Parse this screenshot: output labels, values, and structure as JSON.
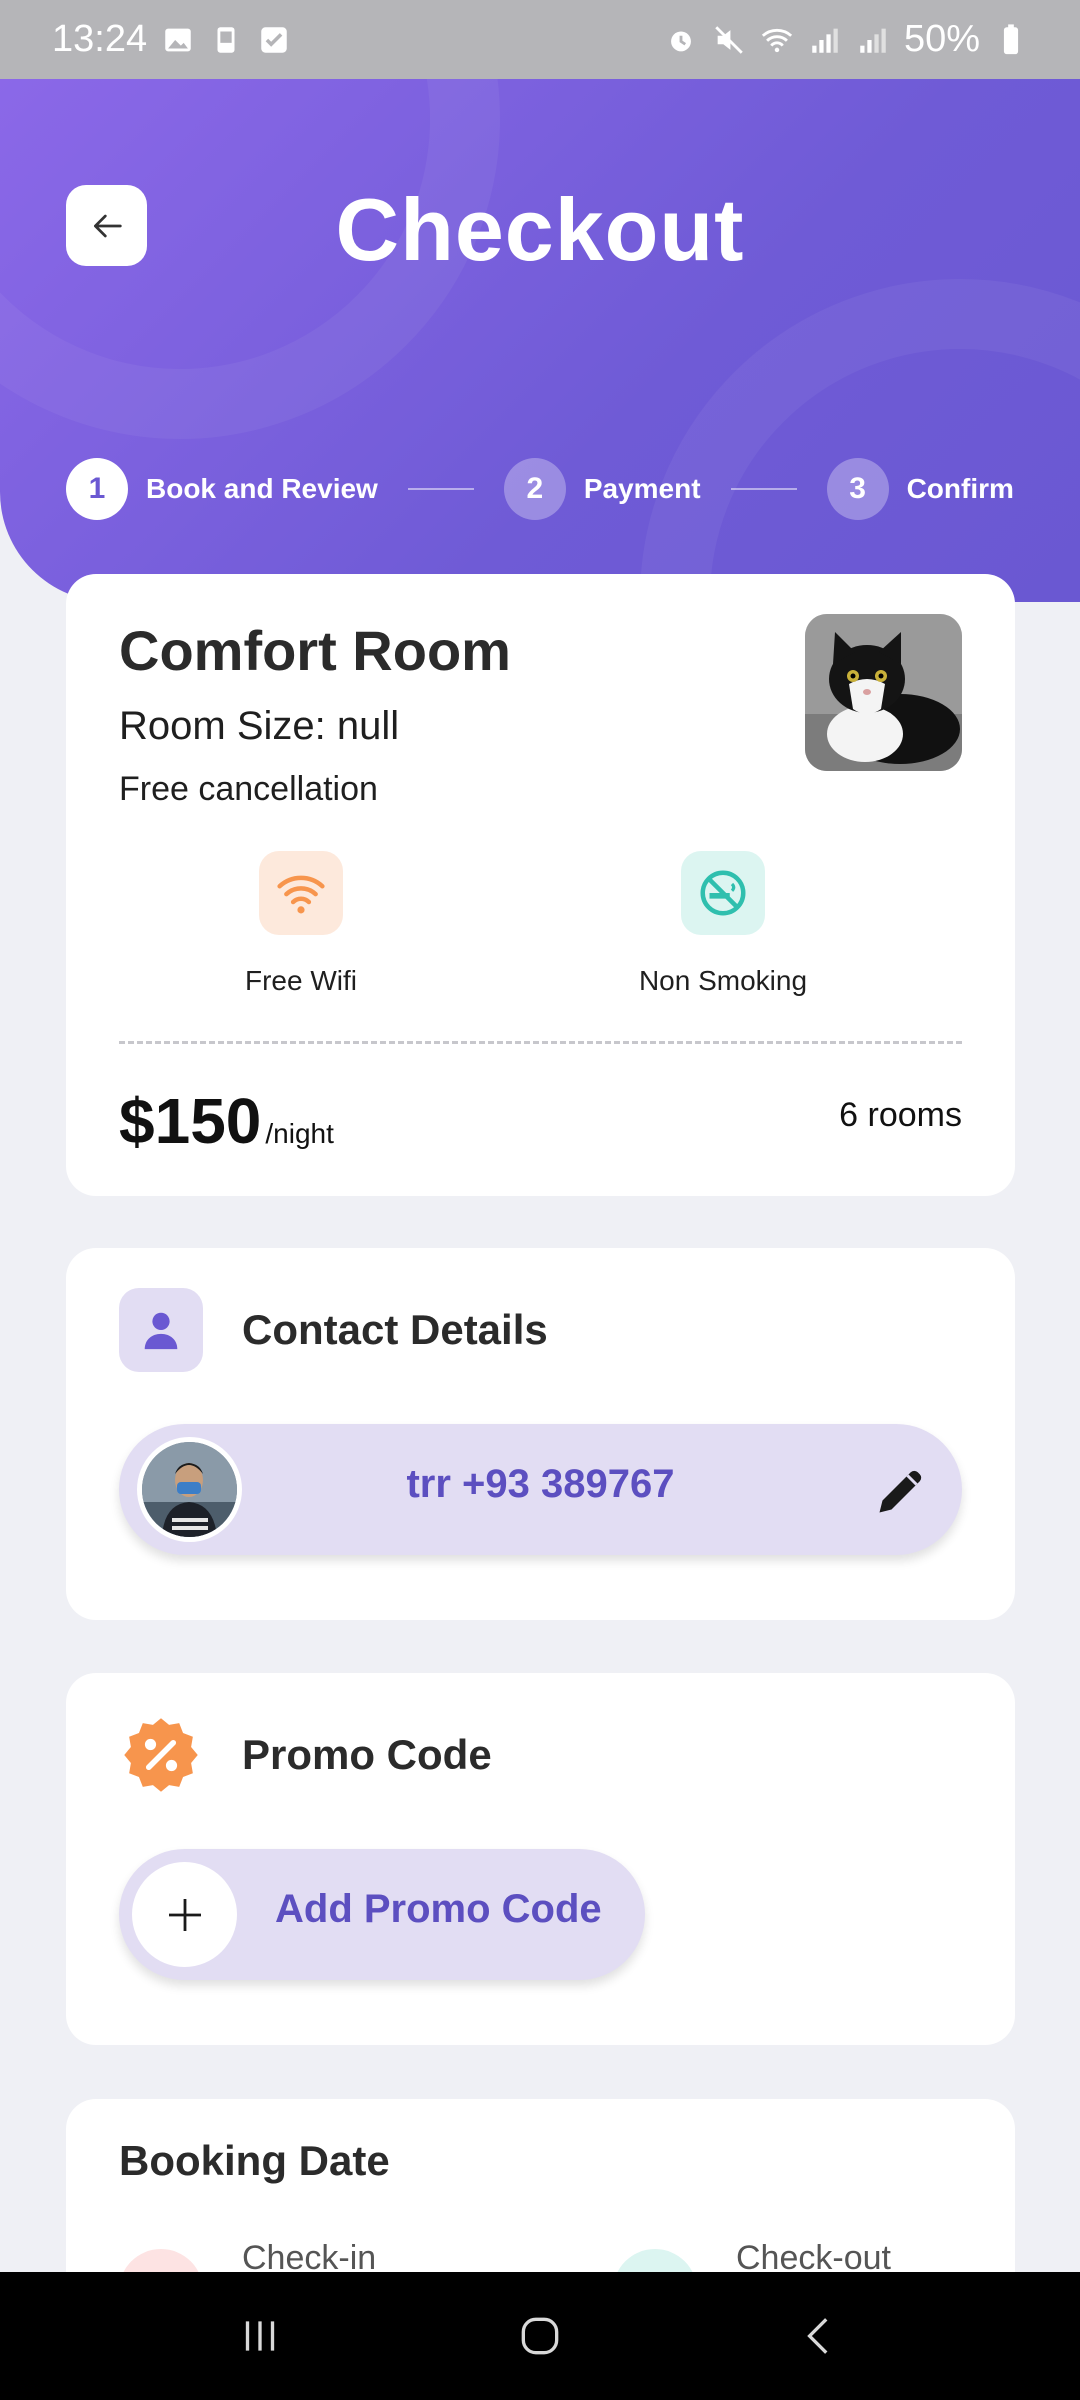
{
  "status_bar": {
    "time": "13:24",
    "battery": "50%",
    "icons_left": [
      "gallery-icon",
      "cast-icon",
      "checkbox-icon"
    ],
    "icons_right": [
      "alarm-icon",
      "mute-icon",
      "wifi-icon",
      "signal-icon",
      "signal-icon",
      "battery-icon"
    ]
  },
  "header": {
    "title": "Checkout",
    "back_icon": "arrow-left-icon",
    "steps": [
      {
        "number": "1",
        "label": "Book and Review",
        "active": true
      },
      {
        "number": "2",
        "label": "Payment",
        "active": false
      },
      {
        "number": "3",
        "label": "Confirm",
        "active": false
      }
    ]
  },
  "room": {
    "title": "Comfort Room",
    "size_text": "Room Size: null",
    "cancellation": "Free cancellation",
    "photo": "cat-photo",
    "amenities": [
      {
        "label": "Free Wifi",
        "icon": "wifi-icon",
        "color": "#f7954d",
        "bg": "#fde9dc"
      },
      {
        "label": "Non Smoking",
        "icon": "no-smoking-icon",
        "color": "#2fbfae",
        "bg": "#dcf5f1"
      }
    ],
    "price": "$150",
    "price_unit": "/night",
    "rooms": "6 rooms"
  },
  "contact": {
    "title": "Contact Details",
    "icon": "person-icon",
    "value": "trr +93 389767",
    "edit_icon": "pencil-icon"
  },
  "promo": {
    "title": "Promo Code",
    "icon": "discount-badge-icon",
    "button_label": "Add Promo Code"
  },
  "booking": {
    "title": "Booking Date",
    "checkin_label": "Check-in",
    "checkout_label": "Check-out"
  },
  "colors": {
    "accent": "#6a58d2",
    "accent_text": "#5c4fc0",
    "pill_bg": "#e2ddf3",
    "orange": "#f7954d",
    "teal": "#2fbfae"
  }
}
